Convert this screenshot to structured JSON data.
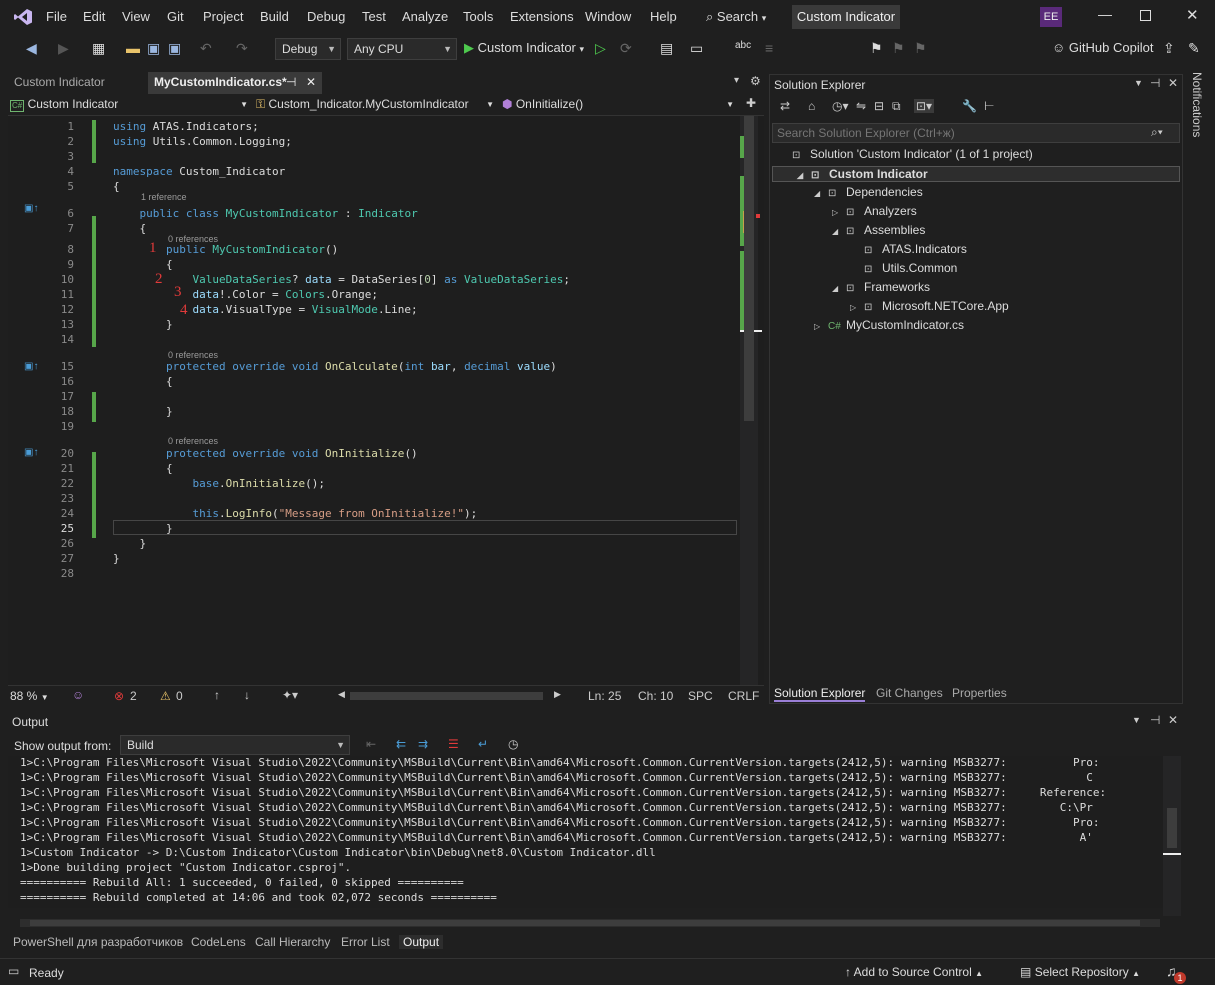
{
  "menu": [
    "File",
    "Edit",
    "View",
    "Git",
    "Project",
    "Build",
    "Debug",
    "Test",
    "Analyze",
    "Tools",
    "Extensions",
    "Window",
    "Help"
  ],
  "search_label": "Search",
  "title_pill": "Custom Indicator",
  "user_initials": "EE",
  "toolbar": {
    "config": "Debug",
    "platform": "Any CPU",
    "run_target": "Custom Indicator",
    "copilot": "GitHub Copilot"
  },
  "doc_tabs": {
    "inactive": "Custom Indicator",
    "active": "MyCustomIndicator.cs*"
  },
  "nav": {
    "project": "Custom Indicator",
    "class": "Custom_Indicator.MyCustomIndicator",
    "member": "OnInitialize()"
  },
  "code_lines": [
    {
      "n": "1",
      "html": "<span class=\"kw\">using</span> ATAS.Indicators;"
    },
    {
      "n": "2",
      "html": "<span class=\"kw\">using</span> Utils.Common.Logging;"
    },
    {
      "n": "3",
      "html": ""
    },
    {
      "n": "4",
      "html": "<span class=\"kw\">namespace</span> Custom_Indicator"
    },
    {
      "n": "5",
      "html": "{"
    },
    {
      "n": "6",
      "html": "    <span class=\"kw\">public</span> <span class=\"kw\">class</span> <span class=\"ty\">MyCustomIndicator</span> : <span class=\"ty\">Indicator</span>"
    },
    {
      "n": "7",
      "html": "    {"
    },
    {
      "n": "8",
      "html": "        <span class=\"kw\">public</span> <span class=\"ty\">MyCustomIndicator</span>()"
    },
    {
      "n": "9",
      "html": "        {"
    },
    {
      "n": "10",
      "html": "            <span class=\"ty\">ValueDataSeries</span>? <span class=\"vr\">data</span> = DataSeries[<span class=\"nm\">0</span>] <span class=\"kw\">as</span> <span class=\"ty\">ValueDataSeries</span>;"
    },
    {
      "n": "11",
      "html": "            <span class=\"vr\">data</span>!.Color = <span class=\"ty\">Colors</span>.Orange;"
    },
    {
      "n": "12",
      "html": "            <span class=\"vr\">data</span>.VisualType = <span class=\"ty\">VisualMode</span>.Line;"
    },
    {
      "n": "13",
      "html": "        }"
    },
    {
      "n": "14",
      "html": ""
    },
    {
      "n": "15",
      "html": "        <span class=\"kw\">protected</span> <span class=\"kw\">override</span> <span class=\"kw\">void</span> <span class=\"fn\">OnCalculate</span>(<span class=\"kw\">int</span> <span class=\"vr\">bar</span>, <span class=\"kw\">decimal</span> <span class=\"vr\">value</span>)"
    },
    {
      "n": "16",
      "html": "        {"
    },
    {
      "n": "17",
      "html": ""
    },
    {
      "n": "18",
      "html": "        }"
    },
    {
      "n": "19",
      "html": ""
    },
    {
      "n": "20",
      "html": "        <span class=\"kw\">protected</span> <span class=\"kw\">override</span> <span class=\"kw\">void</span> <span class=\"fn\">OnInitialize</span>()"
    },
    {
      "n": "21",
      "html": "        {"
    },
    {
      "n": "22",
      "html": "            <span class=\"kw\">base</span>.<span class=\"fn\">OnInitialize</span>();"
    },
    {
      "n": "23",
      "html": ""
    },
    {
      "n": "24",
      "html": "            <span class=\"kw\">this</span>.<span class=\"fn\">LogInfo</span>(<span class=\"st\">\"Message from OnInitialize!\"</span>);"
    },
    {
      "n": "25",
      "html": "        }"
    },
    {
      "n": "26",
      "html": "    }"
    },
    {
      "n": "27",
      "html": "}"
    },
    {
      "n": "28",
      "html": ""
    }
  ],
  "references": {
    "class": "1 reference",
    "ctor": "0 references",
    "calc": "0 references",
    "init": "0 references"
  },
  "annotations": [
    "1",
    "2",
    "3",
    "4"
  ],
  "editor_status": {
    "zoom": "88 %",
    "errors": "2",
    "warnings": "0",
    "ln": "Ln: 25",
    "ch": "Ch: 10",
    "spc": "SPC",
    "crlf": "CRLF"
  },
  "solution_explorer": {
    "title": "Solution Explorer",
    "search_placeholder": "Search Solution Explorer (Ctrl+ж)",
    "items": [
      {
        "label": "Solution 'Custom Indicator' (1 of 1 project)",
        "indent": 0
      },
      {
        "label": "Custom Indicator",
        "indent": 1
      },
      {
        "label": "Dependencies",
        "indent": 2
      },
      {
        "label": "Analyzers",
        "indent": 3
      },
      {
        "label": "Assemblies",
        "indent": 3
      },
      {
        "label": "ATAS.Indicators",
        "indent": 4
      },
      {
        "label": "Utils.Common",
        "indent": 4
      },
      {
        "label": "Frameworks",
        "indent": 3
      },
      {
        "label": "Microsoft.NETCore.App",
        "indent": 4
      },
      {
        "label": "MyCustomIndicator.cs",
        "indent": 2
      }
    ],
    "tabs": [
      "Solution Explorer",
      "Git Changes",
      "Properties"
    ]
  },
  "notifications_label": "Notifications",
  "output": {
    "title": "Output",
    "show_from_label": "Show output from:",
    "source": "Build",
    "lines": [
      "1>C:\\Program Files\\Microsoft Visual Studio\\2022\\Community\\MSBuild\\Current\\Bin\\amd64\\Microsoft.Common.CurrentVersion.targets(2412,5): warning MSB3277:          Pro:",
      "1>C:\\Program Files\\Microsoft Visual Studio\\2022\\Community\\MSBuild\\Current\\Bin\\amd64\\Microsoft.Common.CurrentVersion.targets(2412,5): warning MSB3277:            C",
      "1>C:\\Program Files\\Microsoft Visual Studio\\2022\\Community\\MSBuild\\Current\\Bin\\amd64\\Microsoft.Common.CurrentVersion.targets(2412,5): warning MSB3277:     Reference:",
      "1>C:\\Program Files\\Microsoft Visual Studio\\2022\\Community\\MSBuild\\Current\\Bin\\amd64\\Microsoft.Common.CurrentVersion.targets(2412,5): warning MSB3277:        C:\\Pr",
      "1>C:\\Program Files\\Microsoft Visual Studio\\2022\\Community\\MSBuild\\Current\\Bin\\amd64\\Microsoft.Common.CurrentVersion.targets(2412,5): warning MSB3277:          Pro:",
      "1>C:\\Program Files\\Microsoft Visual Studio\\2022\\Community\\MSBuild\\Current\\Bin\\amd64\\Microsoft.Common.CurrentVersion.targets(2412,5): warning MSB3277:           A'",
      "1>Custom Indicator -> D:\\Custom Indicator\\Custom Indicator\\bin\\Debug\\net8.0\\Custom Indicator.dll",
      "1>Done building project \"Custom Indicator.csproj\".",
      "========== Rebuild All: 1 succeeded, 0 failed, 0 skipped ==========",
      "========== Rebuild completed at 14:06 and took 02,072 seconds =========="
    ]
  },
  "bottom_tabs": [
    "PowerShell для разработчиков",
    "CodeLens",
    "Call Hierarchy",
    "Error List",
    "Output"
  ],
  "status": {
    "ready": "Ready",
    "add_source": "Add to Source Control",
    "select_repo": "Select Repository",
    "notif_count": "1"
  }
}
